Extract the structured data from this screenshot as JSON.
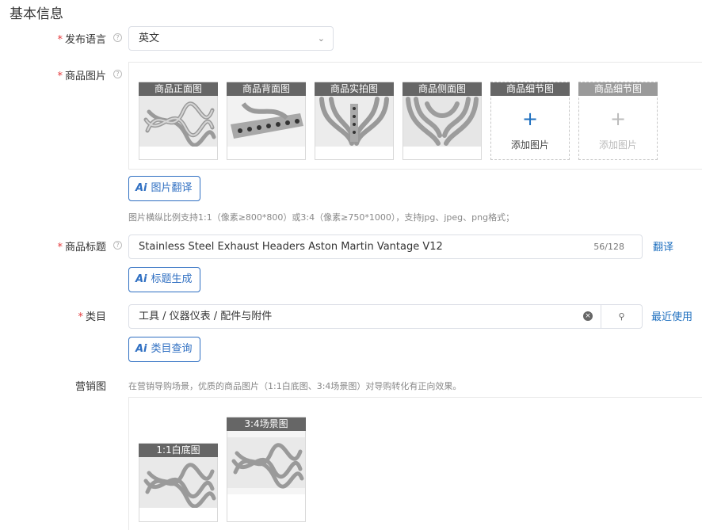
{
  "section": {
    "title": "基本信息"
  },
  "language": {
    "label": "发布语言",
    "value": "英文"
  },
  "images": {
    "label": "商品图片",
    "slots": [
      {
        "caption": "商品正面图"
      },
      {
        "caption": "商品背面图"
      },
      {
        "caption": "商品实拍图"
      },
      {
        "caption": "商品侧面图"
      },
      {
        "caption": "商品细节图",
        "add_label": "添加图片"
      },
      {
        "caption": "商品细节图",
        "add_label": "添加图片"
      }
    ],
    "translate_button": "图片翻译",
    "hint": "图片横纵比例支持1:1（像素≥800*800）或3:4（像素≥750*1000），支持jpg、jpeg、png格式；"
  },
  "title": {
    "label": "商品标题",
    "value": "Stainless Steel Exhaust Headers Aston Martin Vantage V12",
    "count": "56/128",
    "translate_link": "翻译",
    "generate_button": "标题生成"
  },
  "category": {
    "label": "类目",
    "value": "工具 / 仪器仪表 / 配件与附件",
    "recent_link": "最近使用",
    "query_button": "类目查询"
  },
  "marketing": {
    "label": "营销图",
    "hint": "在营销导购场景，优质的商品图片（1:1白底图、3:4场景图）对导购转化有正向效果。",
    "slots": [
      {
        "caption": "1:1白底图"
      },
      {
        "caption": "3:4场景图"
      }
    ]
  },
  "ai_badge": "Ai",
  "colors": {
    "accent": "#1e6fbf",
    "required": "#e4393c",
    "caption_bg": "#666666"
  }
}
